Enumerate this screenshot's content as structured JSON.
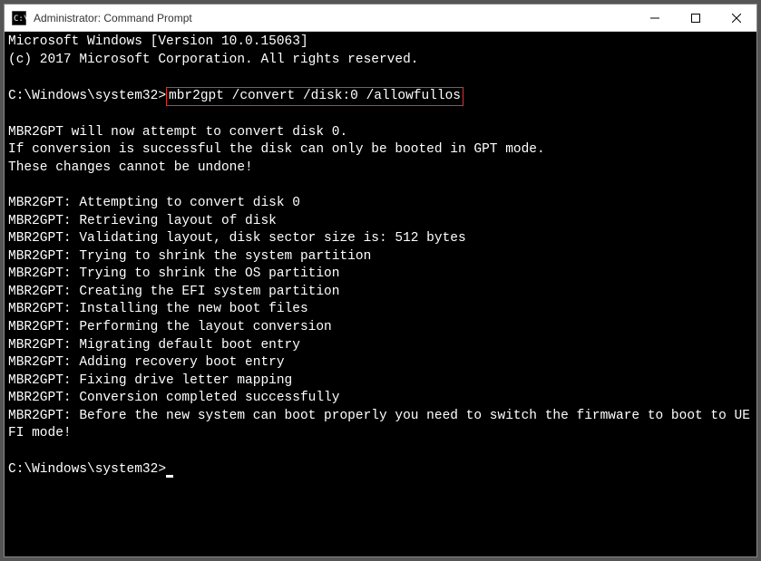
{
  "window": {
    "title": "Administrator: Command Prompt"
  },
  "terminal": {
    "line_version": "Microsoft Windows [Version 10.0.15063]",
    "line_copyright": "(c) 2017 Microsoft Corporation. All rights reserved.",
    "prompt1": "C:\\Windows\\system32>",
    "command": "mbr2gpt /convert /disk:0 /allowfullos",
    "blank": "",
    "msg1": "MBR2GPT will now attempt to convert disk 0.",
    "msg2": "If conversion is successful the disk can only be booted in GPT mode.",
    "msg3": "These changes cannot be undone!",
    "step1": "MBR2GPT: Attempting to convert disk 0",
    "step2": "MBR2GPT: Retrieving layout of disk",
    "step3": "MBR2GPT: Validating layout, disk sector size is: 512 bytes",
    "step4": "MBR2GPT: Trying to shrink the system partition",
    "step5": "MBR2GPT: Trying to shrink the OS partition",
    "step6": "MBR2GPT: Creating the EFI system partition",
    "step7": "MBR2GPT: Installing the new boot files",
    "step8": "MBR2GPT: Performing the layout conversion",
    "step9": "MBR2GPT: Migrating default boot entry",
    "step10": "MBR2GPT: Adding recovery boot entry",
    "step11": "MBR2GPT: Fixing drive letter mapping",
    "step12": "MBR2GPT: Conversion completed successfully",
    "step13": "MBR2GPT: Before the new system can boot properly you need to switch the firmware to boot to UEFI mode!",
    "prompt2": "C:\\Windows\\system32>"
  }
}
